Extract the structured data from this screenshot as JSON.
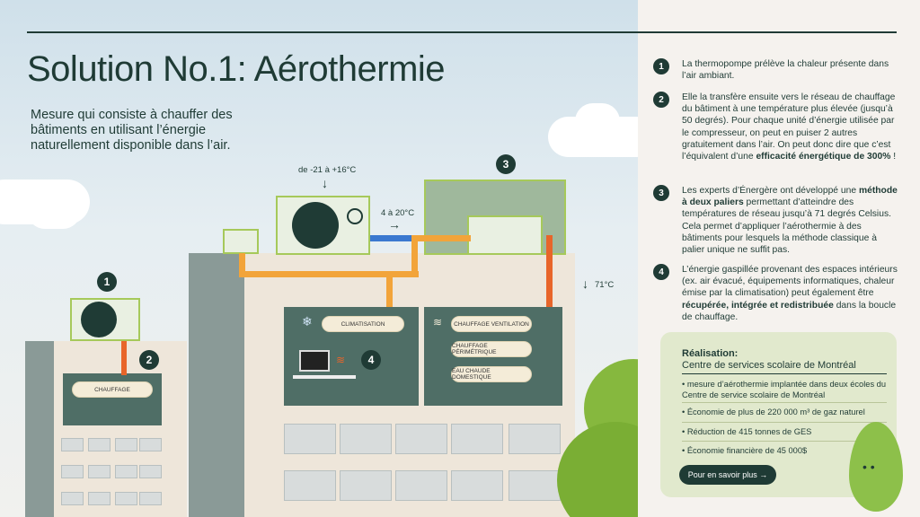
{
  "title": "Solution No.1: Aérothermie",
  "subtitle": "Mesure qui consiste à chauffer des bâtiments en utilisant l’énergie naturellement disponible dans l’air.",
  "diagram": {
    "temp_outdoor": "de -21 à +16°C",
    "temp_mid": "4 à 20°C",
    "temp_out": "71°C",
    "markers": [
      "1",
      "2",
      "3",
      "4"
    ],
    "pill_chauffage": "CHAUFFAGE",
    "pill_clim": "CLIMATISATION",
    "pill_vent": "CHAUFFAGE VENTILATION",
    "pill_perim": "CHAUFFAGE PÉRIMÉTRIQUE",
    "pill_eau": "EAU CHAUDE DOMESTIQUE"
  },
  "steps": [
    {
      "num": "1",
      "text": "La thermopompe prélève la chaleur présente dans l’air ambiant."
    },
    {
      "num": "2",
      "text": "Elle la transfère ensuite vers le réseau de chauffage du bâtiment à une température plus élevée (jusqu’à 50 degrés). Pour chaque unité d’énergie utilisée par le compresseur, on peut en puiser 2 autres gratuitement dans l’air. On peut donc dire que c’est l’équivalent d’une ",
      "bold": "efficacité énergétique de 300%",
      "tail": " !"
    },
    {
      "num": "3",
      "pre": "Les experts d’Énergère ont développé une ",
      "bold": "méthode à deux paliers",
      "text": " permettant d’atteindre des températures de réseau jusqu’à 71 degrés Celsius. Cela permet d’appliquer l’aérothermie à des bâtiments pour lesquels la méthode classique à palier unique ne suffit pas."
    },
    {
      "num": "4",
      "pre": "L’énergie gaspillée provenant des espaces intérieurs (ex. air évacué, équipements informatiques, chaleur émise par la climatisation) peut également être ",
      "bold": "récupérée, intégrée et redistribuée",
      "text": " dans la boucle de chauffage."
    }
  ],
  "card": {
    "heading": "Réalisation:",
    "subheading": "Centre de services scolaire de Montréal",
    "items": [
      "• mesure d’aérothermie implantée dans deux écoles du Centre de service scolaire de Montréal",
      "• Économie de plus de 220 000 m³ de gaz naturel",
      "• Réduction de 415 tonnes de GES",
      "• Économie financière de 45 000$"
    ],
    "button": "Pour en savoir plus →"
  },
  "colors": {
    "dark": "#1f3b35",
    "accent": "#a6c95a",
    "pipe_hot": "#e8652a",
    "pipe_warm": "#f2a43a",
    "pipe_cold": "#3a78d0"
  }
}
